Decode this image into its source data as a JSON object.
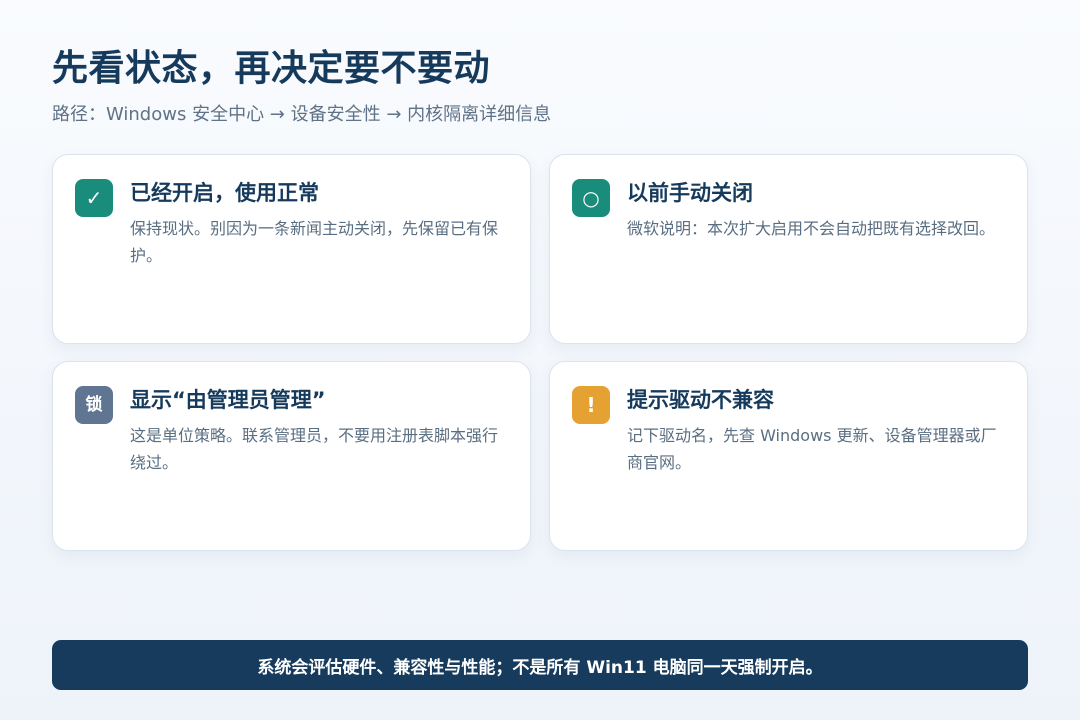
{
  "header": {
    "title": "先看状态，再决定要不要动",
    "breadcrumb": "路径：Windows 安全中心 → 设备安全性 → 内核隔离详细信息"
  },
  "cards": [
    {
      "icon": "check-icon",
      "icon_glyph": "✓",
      "icon_color": "#1a8c7c",
      "title": "已经开启，使用正常",
      "body": "保持现状。别因为一条新闻主动关闭，先保留已有保护。"
    },
    {
      "icon": "circle-icon",
      "icon_glyph": "○",
      "icon_color": "#1a8c7c",
      "title": "以前手动关闭",
      "body": "微软说明：本次扩大启用不会自动把既有选择改回。"
    },
    {
      "icon": "lock-icon",
      "icon_glyph": "锁",
      "icon_color": "#5f7591",
      "title": "显示“由管理员管理”",
      "body": "这是单位策略。联系管理员，不要用注册表脚本强行绕过。"
    },
    {
      "icon": "warning-icon",
      "icon_glyph": "!",
      "icon_color": "#e5a232",
      "title": "提示驱动不兼容",
      "body": "记下驱动名，先查 Windows 更新、设备管理器或厂商官网。"
    }
  ],
  "footer": {
    "banner": "系统会评估硬件、兼容性与性能；不是所有 Win11 电脑同一天强制开启。"
  }
}
